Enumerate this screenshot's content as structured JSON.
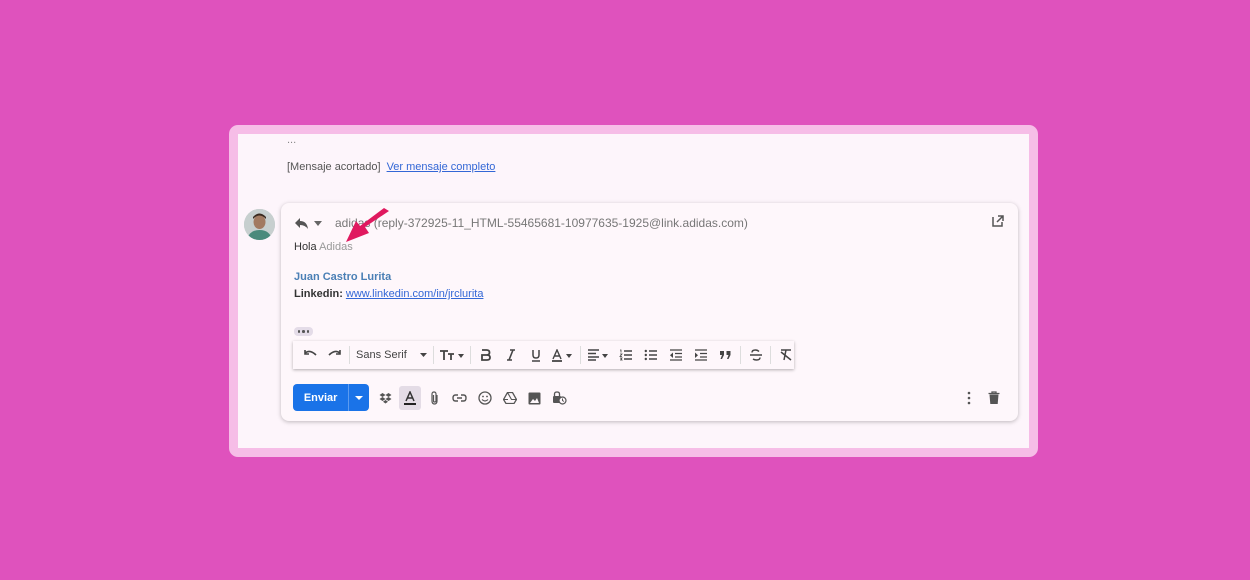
{
  "thread": {
    "ellipsis": "...",
    "trimmed_label": "[Mensaje acortado]",
    "view_full_link": "Ver mensaje completo"
  },
  "compose": {
    "recipient": "adidas (reply-372925-11_HTML-55465681-10977635-1925@link.adidas.com)",
    "greeting": "Hola",
    "greeting_name": "Adidas",
    "signature_name": "Juan Castro Lurita",
    "linkedin_label": "Linkedin:",
    "linkedin_url": "www.linkedin.com/in/jrclurita"
  },
  "toolbar": {
    "font_family": "Sans Serif",
    "icons": [
      "undo-icon",
      "redo-icon",
      "font-size-icon",
      "bold-icon",
      "italic-icon",
      "underline-icon",
      "text-color-icon",
      "align-icon",
      "numbered-list-icon",
      "bulleted-list-icon",
      "indent-less-icon",
      "indent-more-icon",
      "quote-icon",
      "strikethrough-icon",
      "remove-formatting-icon"
    ]
  },
  "bottom_bar": {
    "send_label": "Enviar",
    "icons": [
      "dropbox-icon",
      "formatting-options-icon",
      "attach-icon",
      "link-icon",
      "emoji-icon",
      "drive-icon",
      "photo-icon",
      "confidential-mode-icon",
      "more-options-icon",
      "trash-icon"
    ]
  },
  "colors": {
    "background": "#df52bd",
    "frame": "#f6bde7",
    "send_button": "#1a73e8",
    "link": "#3367d6",
    "annotation_arrow": "#e0195f"
  }
}
